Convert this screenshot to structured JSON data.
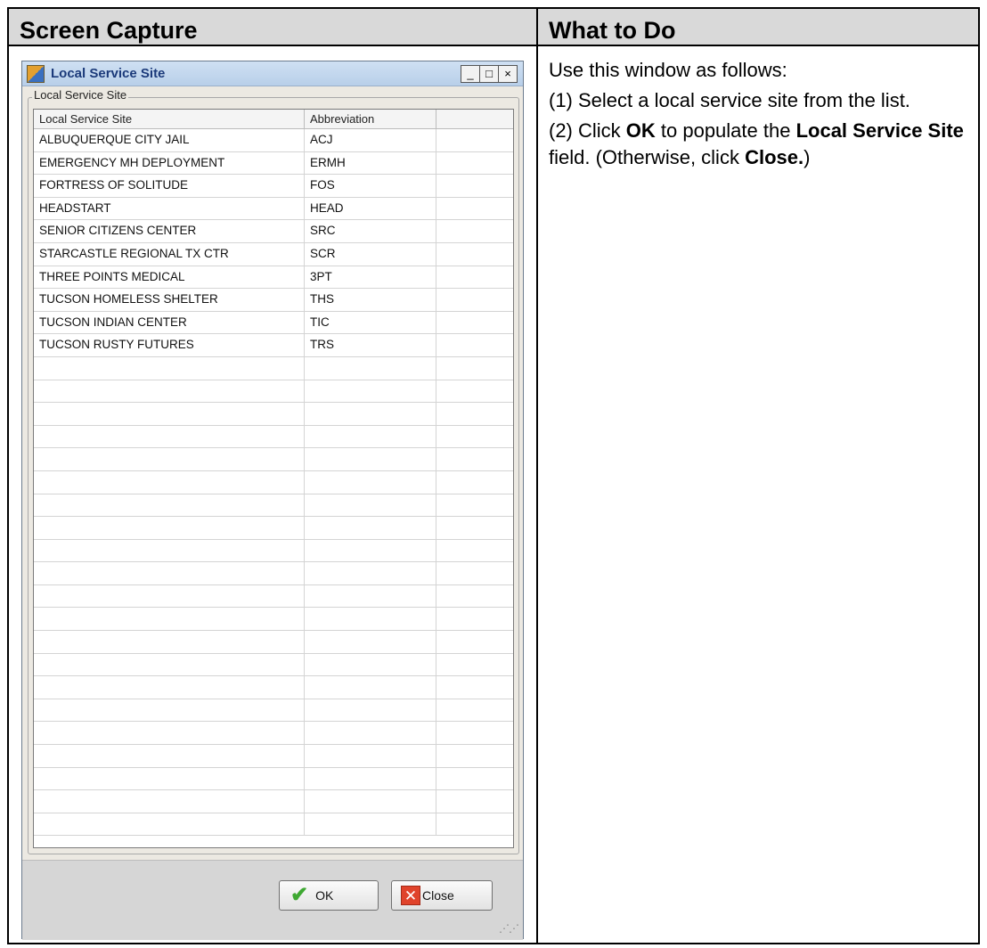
{
  "table": {
    "header_left": "Screen Capture",
    "header_right": "What to Do"
  },
  "window": {
    "title": "Local Service Site",
    "controls": {
      "minimize": "_",
      "maximize": "□",
      "close": "×"
    },
    "group_label": "Local Service Site",
    "columns": {
      "site": "Local Service Site",
      "abbreviation": "Abbreviation"
    },
    "rows": [
      {
        "site": "ALBUQUERQUE CITY JAIL",
        "abbr": "ACJ"
      },
      {
        "site": "EMERGENCY MH DEPLOYMENT",
        "abbr": "ERMH"
      },
      {
        "site": "FORTRESS OF SOLITUDE",
        "abbr": "FOS"
      },
      {
        "site": "HEADSTART",
        "abbr": "HEAD"
      },
      {
        "site": "SENIOR CITIZENS CENTER",
        "abbr": "SRC"
      },
      {
        "site": "STARCASTLE REGIONAL TX CTR",
        "abbr": "SCR"
      },
      {
        "site": "THREE POINTS MEDICAL",
        "abbr": "3PT"
      },
      {
        "site": "TUCSON HOMELESS SHELTER",
        "abbr": "THS"
      },
      {
        "site": "TUCSON INDIAN CENTER",
        "abbr": "TIC"
      },
      {
        "site": "TUCSON RUSTY FUTURES",
        "abbr": "TRS"
      }
    ],
    "ok_label": "OK",
    "close_label": "Close",
    "ok_icon": "checkmark-icon",
    "close_icon": "red-x-icon"
  },
  "instructions": {
    "intro": "Use this window as follows:",
    "step1": "(1) Select a local service site from the list.",
    "step2_parts": [
      "(2) Click ",
      "OK",
      " to populate the ",
      "Local Service Site",
      " field. (Otherwise, click ",
      "Close.",
      ")"
    ]
  }
}
